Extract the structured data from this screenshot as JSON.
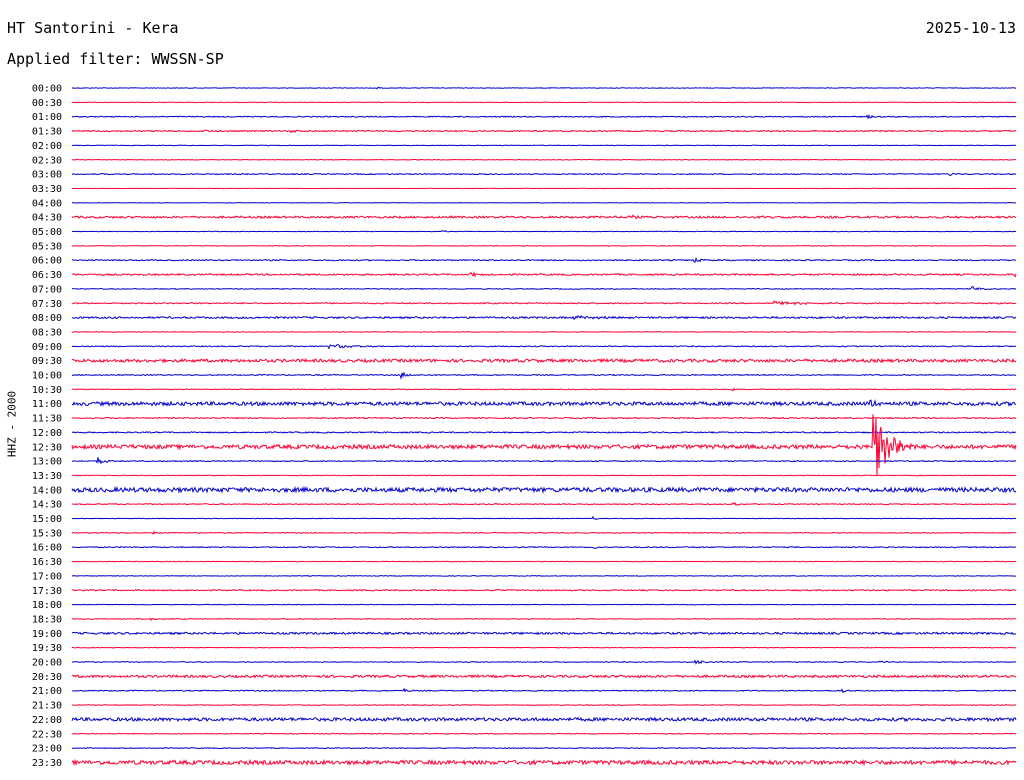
{
  "header": {
    "station": "HT Santorini - Kera",
    "date": "2025-10-13",
    "filter": "Applied filter: WWSSN-SP"
  },
  "chart_data": {
    "type": "line",
    "title": "HT Santorini - Kera",
    "subtitle": "Applied filter: WWSSN-SP",
    "date": "2025-10-13",
    "ylabel": "HHZ - 2000",
    "xlabel": "",
    "minutes_per_row": 30,
    "xlim_minutes": [
      0,
      30
    ],
    "row_colors": [
      "#0000cc",
      "#ff0033"
    ],
    "ticks": [
      "00:00",
      "00:30",
      "01:00",
      "01:30",
      "02:00",
      "02:30",
      "03:00",
      "03:30",
      "04:00",
      "04:30",
      "05:00",
      "05:30",
      "06:00",
      "06:30",
      "07:00",
      "07:30",
      "08:00",
      "08:30",
      "09:00",
      "09:30",
      "10:00",
      "10:30",
      "11:00",
      "11:30",
      "12:00",
      "12:30",
      "13:00",
      "13:30",
      "14:00",
      "14:30",
      "15:00",
      "15:30",
      "16:00",
      "16:30",
      "17:00",
      "17:30",
      "18:00",
      "18:30",
      "19:00",
      "19:30",
      "20:00",
      "20:30",
      "21:00",
      "21:30",
      "22:00",
      "22:30",
      "23:00",
      "23:30"
    ],
    "noise_level": [
      0.3,
      0.3,
      0.5,
      0.6,
      0.3,
      0.3,
      0.5,
      0.2,
      0.2,
      1.0,
      0.3,
      0.3,
      0.6,
      0.8,
      0.4,
      0.6,
      0.9,
      0.3,
      0.5,
      1.5,
      0.5,
      0.4,
      1.8,
      0.6,
      0.6,
      2.0,
      0.5,
      0.3,
      2.2,
      0.5,
      0.3,
      0.4,
      0.5,
      0.3,
      0.3,
      0.6,
      0.3,
      0.4,
      1.0,
      0.3,
      0.4,
      1.2,
      0.5,
      0.4,
      1.6,
      0.4,
      0.4,
      2.0
    ],
    "events": [
      {
        "row": 0,
        "minute": 9.7,
        "amplitude": 1.5,
        "duration": 0.2
      },
      {
        "row": 3,
        "minute": 4.2,
        "amplitude": 1.5,
        "duration": 0.4
      },
      {
        "row": 3,
        "minute": 7.0,
        "amplitude": 1.5,
        "duration": 0.5
      },
      {
        "row": 2,
        "minute": 25.3,
        "amplitude": 1.5,
        "duration": 0.5
      },
      {
        "row": 6,
        "minute": 27.9,
        "amplitude": 1.5,
        "duration": 0.5
      },
      {
        "row": 9,
        "minute": 17.7,
        "amplitude": 2.0,
        "duration": 0.8
      },
      {
        "row": 9,
        "minute": 21.9,
        "amplitude": 2.0,
        "duration": 1.2
      },
      {
        "row": 10,
        "minute": 11.8,
        "amplitude": 1.5,
        "duration": 0.3
      },
      {
        "row": 12,
        "minute": 19.8,
        "amplitude": 2.0,
        "duration": 0.8
      },
      {
        "row": 13,
        "minute": 12.7,
        "amplitude": 2.5,
        "duration": 1.0
      },
      {
        "row": 13,
        "minute": 30.0,
        "amplitude": 2.0,
        "duration": 0.6
      },
      {
        "row": 14,
        "minute": 28.6,
        "amplitude": 3.0,
        "duration": 0.7
      },
      {
        "row": 15,
        "minute": 22.3,
        "amplitude": 2.0,
        "duration": 2.5
      },
      {
        "row": 16,
        "minute": 16.0,
        "amplitude": 2.0,
        "duration": 2.0
      },
      {
        "row": 18,
        "minute": 8.2,
        "amplitude": 2.0,
        "duration": 3.0
      },
      {
        "row": 20,
        "minute": 10.5,
        "amplitude": 3.0,
        "duration": 0.5
      },
      {
        "row": 21,
        "minute": 21.0,
        "amplitude": 1.5,
        "duration": 0.3
      },
      {
        "row": 22,
        "minute": 25.4,
        "amplitude": 4.0,
        "duration": 0.6
      },
      {
        "row": 25,
        "minute": 25.5,
        "amplitude": 40.0,
        "duration": 1.3
      },
      {
        "row": 26,
        "minute": 0.8,
        "amplitude": 4.0,
        "duration": 0.7
      },
      {
        "row": 29,
        "minute": 21.0,
        "amplitude": 2.0,
        "duration": 0.5
      },
      {
        "row": 30,
        "minute": 16.6,
        "amplitude": 1.5,
        "duration": 0.3
      },
      {
        "row": 31,
        "minute": 2.6,
        "amplitude": 1.5,
        "duration": 0.4
      },
      {
        "row": 32,
        "minute": 16.6,
        "amplitude": 1.5,
        "duration": 0.5
      },
      {
        "row": 35,
        "minute": 13.5,
        "amplitude": 1.5,
        "duration": 0.4
      },
      {
        "row": 37,
        "minute": 2.5,
        "amplitude": 1.5,
        "duration": 0.6
      },
      {
        "row": 40,
        "minute": 19.8,
        "amplitude": 2.0,
        "duration": 1.2
      },
      {
        "row": 40,
        "minute": 25.6,
        "amplitude": 1.5,
        "duration": 0.6
      },
      {
        "row": 42,
        "minute": 10.6,
        "amplitude": 2.0,
        "duration": 0.3
      },
      {
        "row": 42,
        "minute": 24.5,
        "amplitude": 2.0,
        "duration": 0.4
      }
    ]
  }
}
